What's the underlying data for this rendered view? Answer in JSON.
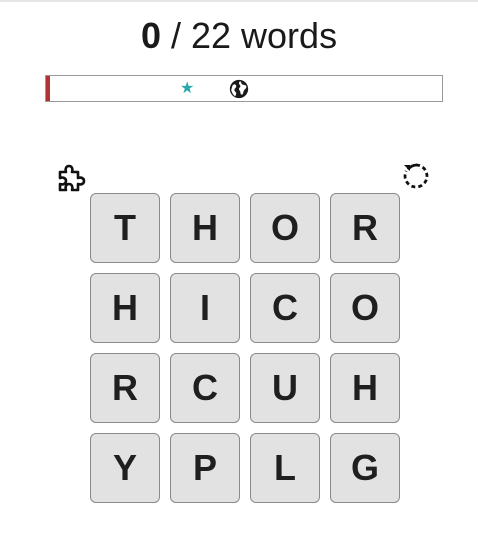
{
  "score": {
    "found": "0",
    "separator": " / ",
    "total": "22",
    "unit": " words"
  },
  "progress": {
    "value": 0,
    "markers": [
      {
        "icon": "star-icon",
        "color": "#2aa8a8"
      },
      {
        "icon": "globe-icon",
        "color": "#1a1a1a"
      }
    ]
  },
  "toolbar": {
    "hint_icon": "puzzle-piece-icon",
    "reset_icon": "rotate-icon"
  },
  "board": {
    "rows": [
      [
        "T",
        "H",
        "O",
        "R"
      ],
      [
        "H",
        "I",
        "C",
        "O"
      ],
      [
        "R",
        "C",
        "U",
        "H"
      ],
      [
        "Y",
        "P",
        "L",
        "G"
      ]
    ]
  }
}
